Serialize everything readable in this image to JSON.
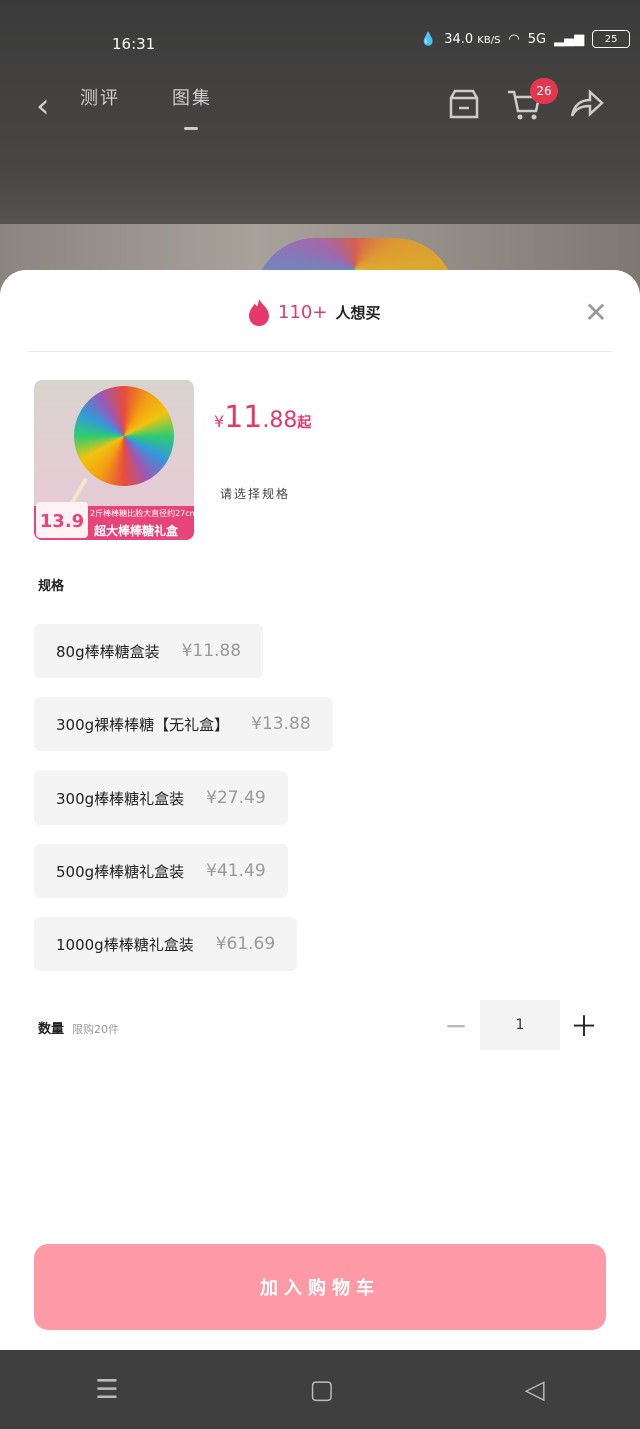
{
  "status_bar": {
    "time": "16:31",
    "net_speed": "34.0",
    "net_unit": "KB/S",
    "signal": "5G",
    "battery": "25"
  },
  "top_nav": {
    "tabs": [
      "测评",
      "图集"
    ],
    "active_tab": 1,
    "cart_count": "26"
  },
  "sheet": {
    "hot_count": "110+",
    "hot_label": "人想买",
    "price_currency": "¥",
    "price_int": "11",
    "price_dec": ".88",
    "price_suffix": "起",
    "select_hint": "请选择规格",
    "thumb": {
      "price": "13.9",
      "line1": "2斤棒棒糖比脸大直径约27cm",
      "line2": "超大棒棒糖礼盒"
    },
    "spec_title": "规格",
    "options": [
      {
        "name": "80g棒棒糖盒装",
        "price": "¥11.88"
      },
      {
        "name": "300g裸棒棒糖【无礼盒】",
        "price": "¥13.88"
      },
      {
        "name": "300g棒棒糖礼盒装",
        "price": "¥27.49"
      },
      {
        "name": "500g棒棒糖礼盒装",
        "price": "¥41.49"
      },
      {
        "name": "1000g棒棒糖礼盒装",
        "price": "¥61.69"
      }
    ],
    "qty_label": "数量",
    "qty_limit": "限购20件",
    "qty_value": "1",
    "add_to_cart": "加入购物车"
  },
  "accent_color": "#e6396a",
  "cta_color": "#fd9aa6"
}
